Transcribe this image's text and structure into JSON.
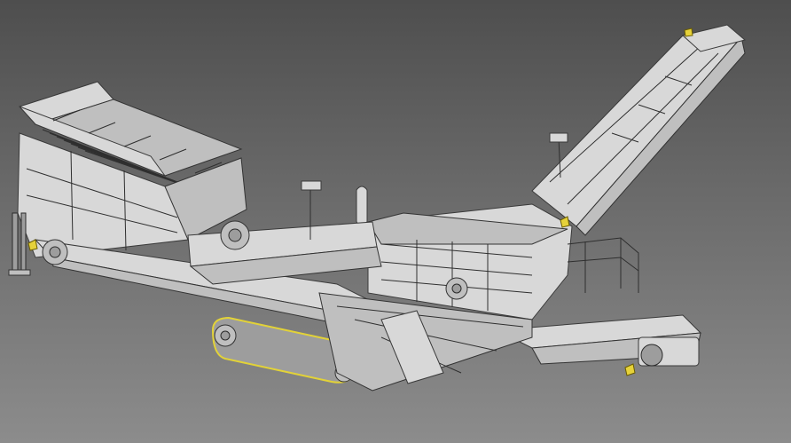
{
  "scene": {
    "subject": "mobile-screening-plant-cad-model",
    "background_gradient": [
      "#4e4e4e",
      "#6b6b6b",
      "#8c8c8c"
    ],
    "model_colors": {
      "light": "#d8d8d8",
      "mid": "#bfbfbf",
      "dark": "#9d9d9d",
      "accent_yellow": "#e6d23a",
      "outline": "#2f2f2f"
    }
  }
}
